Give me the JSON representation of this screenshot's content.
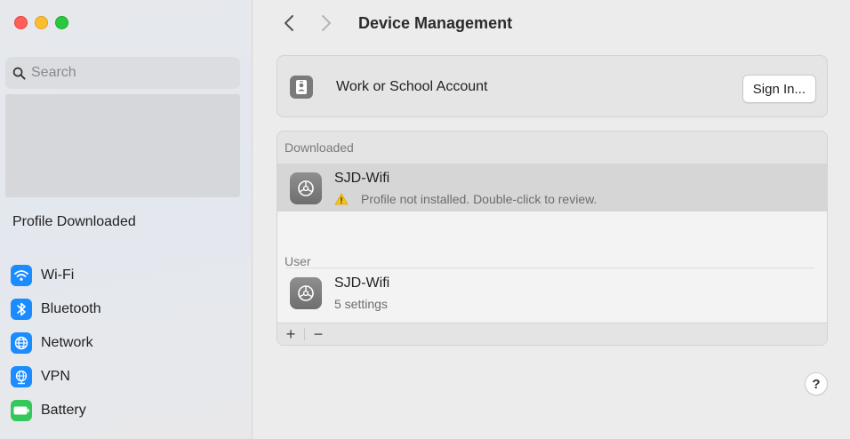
{
  "window": {
    "title": "Device Management"
  },
  "sidebar": {
    "search_placeholder": "Search",
    "profile_label": "Profile Downloaded",
    "items": [
      {
        "label": "Wi-Fi",
        "icon": "wifi-icon",
        "color": "#1a8cff"
      },
      {
        "label": "Bluetooth",
        "icon": "bluetooth-icon",
        "color": "#1a8cff"
      },
      {
        "label": "Network",
        "icon": "globe-icon",
        "color": "#1a8cff"
      },
      {
        "label": "VPN",
        "icon": "vpn-globe-icon",
        "color": "#1a8cff"
      },
      {
        "label": "Battery",
        "icon": "battery-icon",
        "color": "#34c759"
      }
    ]
  },
  "account": {
    "label": "Work or School Account",
    "button": "Sign In..."
  },
  "profiles": {
    "downloaded_header": "Downloaded",
    "downloaded": {
      "name": "SJD-Wifi",
      "status": "Profile not installed. Double-click to review."
    },
    "user_header": "User",
    "user": {
      "name": "SJD-Wifi",
      "status": "5 settings"
    },
    "add_label": "+",
    "remove_label": "−"
  },
  "help_label": "?"
}
